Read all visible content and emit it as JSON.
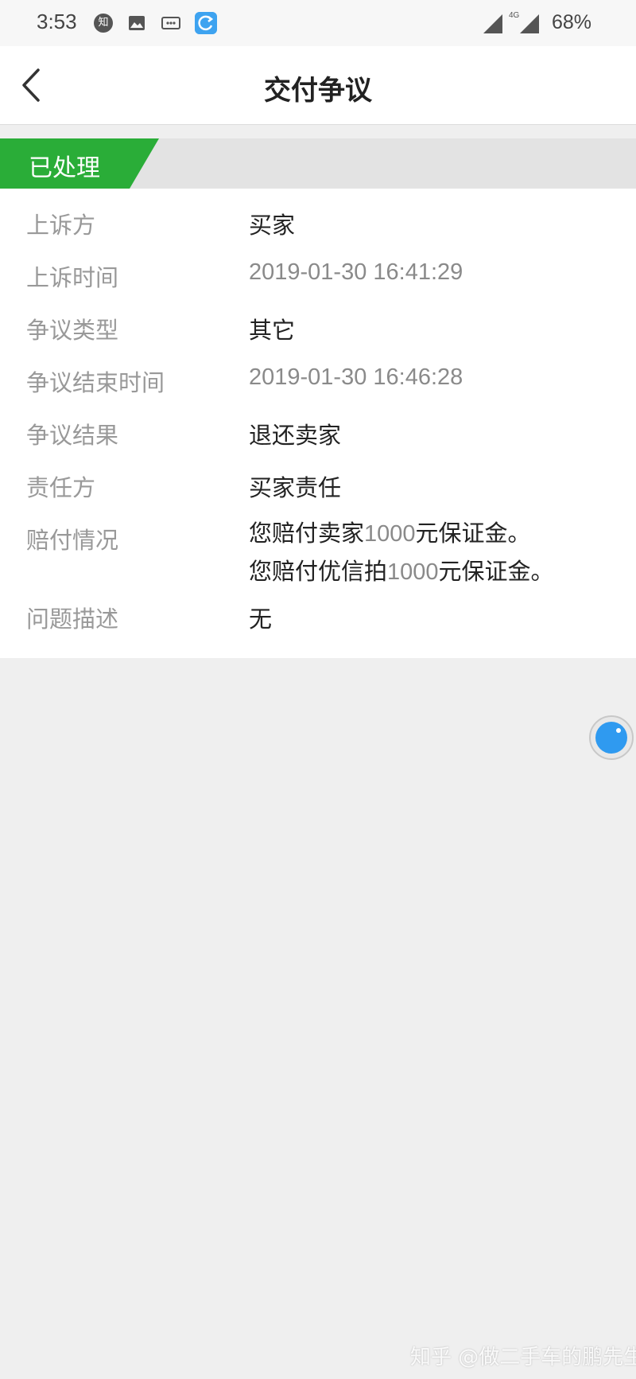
{
  "status_bar": {
    "time": "3:53",
    "notification_app": "知",
    "network": "4G",
    "battery": "68%"
  },
  "nav": {
    "title": "交付争议"
  },
  "banner": {
    "status": "已处理",
    "color": "#2aad38"
  },
  "details": {
    "appellant": {
      "label": "上诉方",
      "value": "买家"
    },
    "appeal_time": {
      "label": "上诉时间",
      "value": "2019-01-30 16:41:29"
    },
    "dispute_type": {
      "label": "争议类型",
      "value": "其它"
    },
    "dispute_end_time": {
      "label": "争议结束时间",
      "value": "2019-01-30 16:46:28"
    },
    "dispute_result": {
      "label": "争议结果",
      "value": "退还卖家"
    },
    "responsible_party": {
      "label": "责任方",
      "value": "买家责任"
    },
    "compensation": {
      "label": "赔付情况",
      "line1_prefix": "您赔付卖家",
      "line1_amount": "1000",
      "line1_suffix": "元保证金。",
      "line2_prefix": "您赔付优信拍",
      "line2_amount": "1000",
      "line2_suffix": "元保证金。"
    },
    "problem_description": {
      "label": "问题描述",
      "value": "无"
    }
  },
  "watermark": "知乎 @做二手车的鹏先生",
  "colors": {
    "accent_green": "#2aad38",
    "float_button_blue": "#2f9af0"
  }
}
